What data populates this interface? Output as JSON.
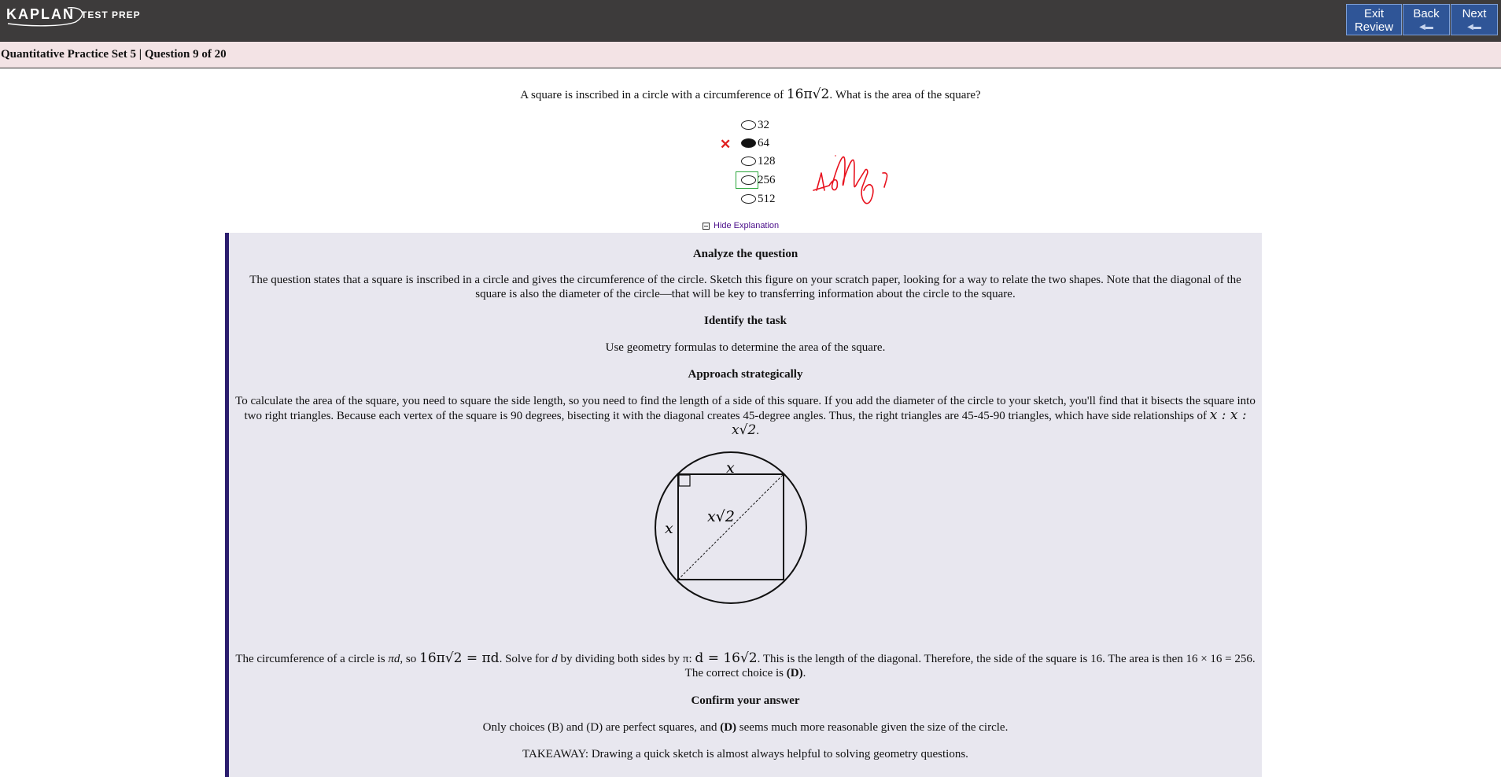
{
  "header": {
    "brand": "KAPLAN",
    "brand_sub": "TEST PREP",
    "buttons": {
      "exit_review_line1": "Exit",
      "exit_review_line2": "Review",
      "back": "Back",
      "next": "Next"
    }
  },
  "subheader": {
    "title": "Quantitative Practice Set 5 | Question 9 of 20"
  },
  "question": {
    "text_before": "A square is inscribed in a circle with a circumference of",
    "math": "16π√2",
    "text_after": ". What is the area of the square?"
  },
  "choices": [
    {
      "label": "32",
      "selected": false
    },
    {
      "label": "64",
      "selected": true
    },
    {
      "label": "128",
      "selected": false
    },
    {
      "label": "256",
      "selected": false,
      "correct": true
    },
    {
      "label": "512",
      "selected": false
    }
  ],
  "marks": {
    "incorrect": "✕"
  },
  "hide_explanation": "Hide Explanation",
  "explanation": {
    "h1": "Analyze the question",
    "p1": "The question states that a square is inscribed in a circle and gives the circumference of the circle. Sketch this figure on your scratch paper, looking for a way to relate the two shapes. Note that the diagonal of the square is also the diameter of the circle—that will be key to transferring information about the circle to the square.",
    "h2": "Identify the task",
    "p2": "Use geometry formulas to determine the area of the square.",
    "h3": "Approach strategically",
    "p3": "To calculate the area of the square, you need to square the side length, so you need to find the length of a side of this square. If you add the diameter of the circle to your sketch, you'll find that it bisects the square into two right triangles. Because each vertex of the square is 90 degrees, bisecting it with the diagonal creates 45-degree angles. Thus, the right triangles are 45-45-90 triangles, which have side relationships of",
    "p3_math": "x : x : x√2",
    "figure": {
      "label_top": "x",
      "label_left": "x",
      "label_diag": "x√2"
    },
    "p4_a": "The circumference of a circle is ",
    "p4_pid": "πd",
    "p4_b": ", so ",
    "p4_eq1": "16π√2 = πd",
    "p4_c": ". Solve for ",
    "p4_d": "d",
    "p4_e": " by dividing both sides by π: ",
    "p4_eq2": "d = 16√2",
    "p4_f": ". This is the length of the diagonal. Therefore, the side of the square is 16. The area is then 16 × 16 = 256. The correct choice is ",
    "p4_g": "(D)",
    "p4_h": ".",
    "h4": "Confirm your answer",
    "p5_a": "Only choices (B) and (D) are perfect squares, and ",
    "p5_b": "(D)",
    "p5_c": " seems much more reasonable given the size of the circle.",
    "p6": "TAKEAWAY: Drawing a quick sketch is almost always helpful to solving geometry questions."
  }
}
